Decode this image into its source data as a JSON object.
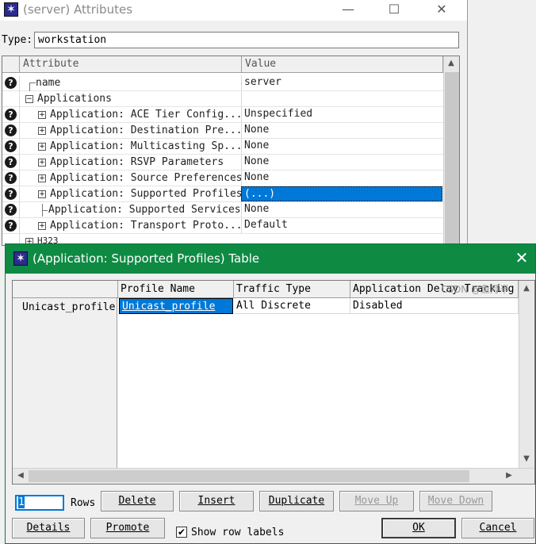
{
  "background_window": {
    "title": "(server) Attributes",
    "icon": "star-burst-icon",
    "type_label": "Type:",
    "type_value": "workstation",
    "columns": {
      "attribute": "Attribute",
      "value": "Value"
    },
    "rows": [
      {
        "name": "name",
        "value": "server"
      },
      {
        "name": "Applications",
        "value": ""
      },
      {
        "name": "Application: ACE Tier Config...",
        "value": "Unspecified"
      },
      {
        "name": "Application: Destination Pre...",
        "value": "None"
      },
      {
        "name": "Application: Multicasting Sp...",
        "value": "None"
      },
      {
        "name": "Application: RSVP Parameters",
        "value": "None"
      },
      {
        "name": "Application: Source Preferences",
        "value": "None"
      },
      {
        "name": "Application: Supported Profiles",
        "value": "(...)"
      },
      {
        "name": "Application: Supported Services",
        "value": "None"
      },
      {
        "name": "Application: Transport Proto...",
        "value": "Default"
      },
      {
        "name": "H323",
        "value": ""
      }
    ]
  },
  "dialog": {
    "title": "(Application: Supported Profiles) Table",
    "icon": "star-burst-icon",
    "columns": [
      "Profile Name",
      "Traffic Type",
      "Application Delay Tracking"
    ],
    "row_labels": [
      "Unicast_profile"
    ],
    "rows": [
      [
        "Unicast_profile",
        "All Discrete",
        "Disabled"
      ]
    ],
    "rows_count": "1",
    "rows_label": "Rows",
    "buttons": {
      "delete": "Delete",
      "insert": "Insert",
      "duplicate": "Duplicate",
      "move_up": "Move Up",
      "move_down": "Move Down",
      "details": "Details",
      "promote": "Promote",
      "ok": "OK",
      "cancel": "Cancel"
    },
    "show_row_labels": {
      "label": "Show row labels",
      "checked": true
    }
  },
  "watermark": "CSDN @鱼月半",
  "colors": {
    "dialog_titlebar": "#0e8a43",
    "selection": "#0078d7"
  }
}
